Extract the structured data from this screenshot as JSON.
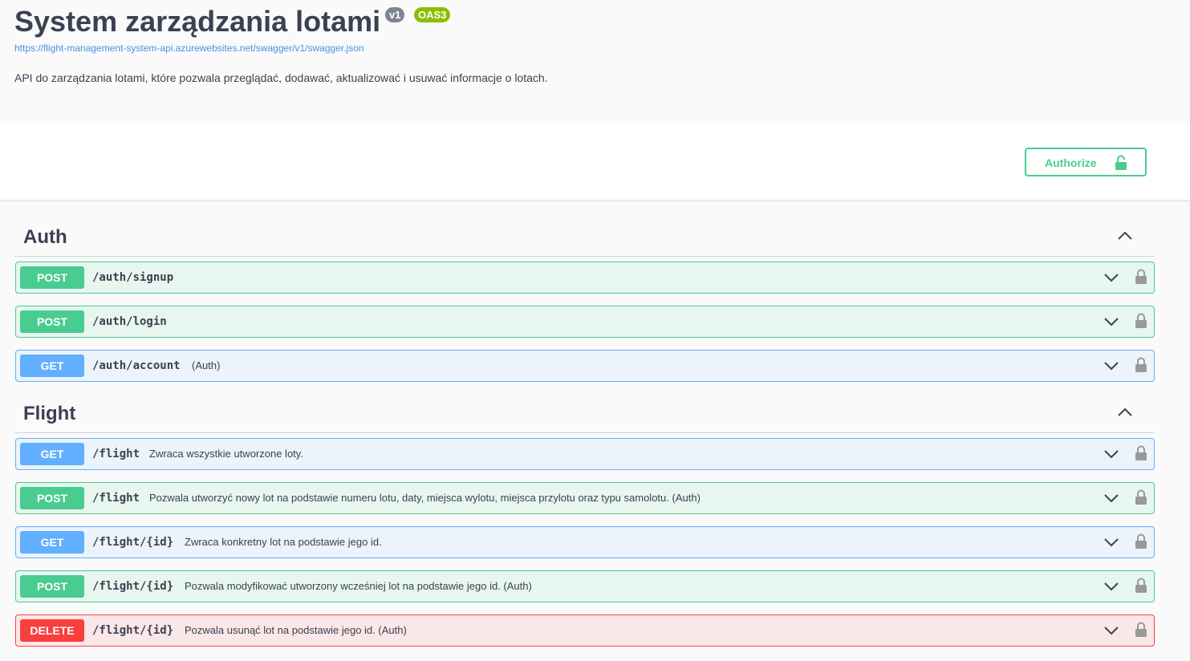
{
  "header": {
    "title": "System zarządzania lotami",
    "version_badge": "v1",
    "oas_badge": "OAS3",
    "spec_url": "https://flight-management-system-api.azurewebsites.net/swagger/v1/swagger.json",
    "description": "API do zarządzania lotami, które pozwala przeglądać, dodawać, aktualizować i usuwać informacje o lotach."
  },
  "scheme": {
    "authorize_label": "Authorize"
  },
  "colors": {
    "post": "#49cc90",
    "get": "#61affe",
    "delete": "#f93e3e",
    "text": "#3b4151",
    "link": "#4990e2"
  },
  "tags": [
    {
      "name": "Auth",
      "operations": [
        {
          "method": "POST",
          "path": "/auth/signup",
          "summary": ""
        },
        {
          "method": "POST",
          "path": "/auth/login",
          "summary": ""
        },
        {
          "method": "GET",
          "path": "/auth/account",
          "summary": "(Auth)"
        }
      ]
    },
    {
      "name": "Flight",
      "operations": [
        {
          "method": "GET",
          "path": "/flight",
          "summary": "Zwraca wszystkie utworzone loty."
        },
        {
          "method": "POST",
          "path": "/flight",
          "summary": "Pozwala utworzyć nowy lot na podstawie numeru lotu, daty, miejsca wylotu, miejsca przylotu oraz typu samolotu. (Auth)"
        },
        {
          "method": "GET",
          "path": "/flight/{id}",
          "summary": "Zwraca konkretny lot na podstawie jego id."
        },
        {
          "method": "POST",
          "path": "/flight/{id}",
          "summary": "Pozwala modyfikować utworzony wcześniej lot na podstawie jego id. (Auth)"
        },
        {
          "method": "DELETE",
          "path": "/flight/{id}",
          "summary": "Pozwala usunąć lot na podstawie jego id. (Auth)"
        }
      ]
    }
  ],
  "icons": {
    "expand": "chevron-down-icon",
    "collapse": "chevron-up-icon",
    "lock": "lock-icon"
  }
}
